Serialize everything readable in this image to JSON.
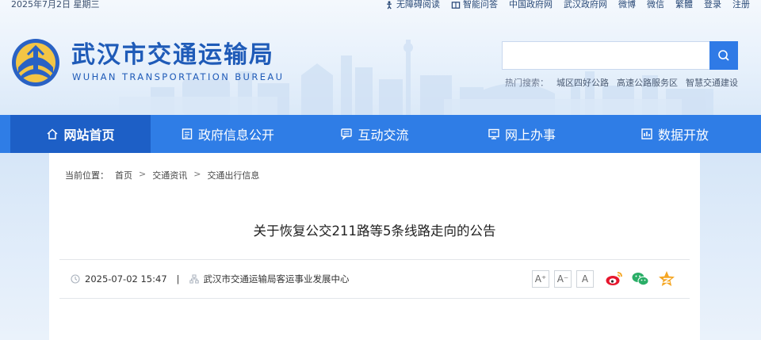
{
  "topbar": {
    "date": "2025年7月2日 星期三",
    "links": [
      {
        "label": "无障碍阅读",
        "icon": "accessibility-icon"
      },
      {
        "label": "智能问答",
        "icon": "book-icon"
      },
      {
        "label": "中国政府网"
      },
      {
        "label": "武汉政府网"
      },
      {
        "label": "微博"
      },
      {
        "label": "微信"
      },
      {
        "label": "繁體"
      },
      {
        "label": "登录"
      },
      {
        "label": "注册"
      }
    ]
  },
  "logo": {
    "cn": "武汉市交通运输局",
    "en": "WUHAN TRANSPORTATION BUREAU"
  },
  "search": {
    "placeholder": "",
    "value": "",
    "hot_label": "热门搜索：",
    "hot_items": [
      "城区四好公路",
      "高速公路服务区",
      "智慧交通建设"
    ]
  },
  "nav": [
    {
      "label": "网站首页",
      "icon": "home-icon",
      "active": true
    },
    {
      "label": "政府信息公开",
      "icon": "document-icon"
    },
    {
      "label": "互动交流",
      "icon": "interaction-icon"
    },
    {
      "label": "网上办事",
      "icon": "service-icon"
    },
    {
      "label": "数据开放",
      "icon": "data-icon"
    }
  ],
  "breadcrumb": {
    "prefix": "当前位置：",
    "items": [
      "首页",
      "交通资讯",
      "交通出行信息"
    ],
    "separator": ">"
  },
  "article": {
    "title": "关于恢复公交211路等5条线路走向的公告",
    "datetime": "2025-07-02 15:47",
    "divider": "|",
    "source": "武汉市交通运输局客运事业发展中心"
  },
  "font_controls": [
    "A⁺",
    "A⁻",
    "A"
  ],
  "share": [
    "weibo-icon",
    "wechat-icon",
    "qzone-icon"
  ],
  "colors": {
    "primary": "#2f7de6",
    "primary_dark": "#1d5fc6",
    "logo_blue": "#1f5bb8",
    "weibo": "#e6162d",
    "wechat": "#2aae67",
    "qzone": "#f5a623"
  }
}
